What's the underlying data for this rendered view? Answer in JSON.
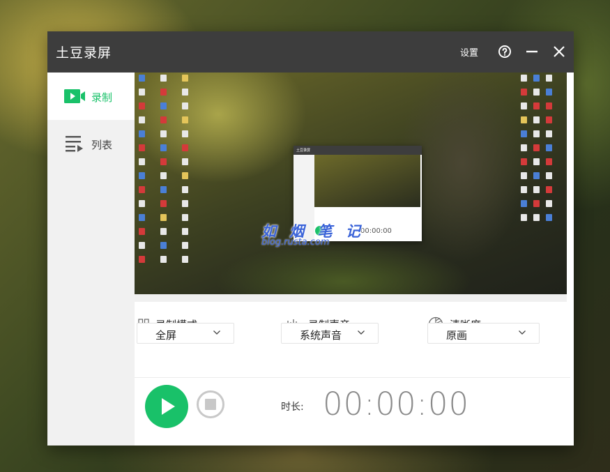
{
  "app": {
    "title": "土豆录屏",
    "settings_label": "设置"
  },
  "sidebar": {
    "items": [
      {
        "label": "录制",
        "icon": "video-camera-icon",
        "active": true
      },
      {
        "label": "列表",
        "icon": "list-play-icon",
        "active": false
      }
    ]
  },
  "preview": {
    "mini_title": "土豆录屏",
    "mini_time": "00:00:00"
  },
  "watermark": {
    "title": "如 烟 笔 记",
    "url": "blog.rusta.com"
  },
  "options": {
    "mode": {
      "label": "录制模式",
      "value": "全屏",
      "icon": "grid-icon"
    },
    "audio": {
      "label": "录制声音",
      "value": "系统声音",
      "icon": "sound-wave-icon"
    },
    "quality": {
      "label": "清晰度",
      "value": "原画",
      "icon": "quality-icon"
    }
  },
  "recording": {
    "duration_label": "时长:",
    "duration_value": "00:00:00"
  },
  "colors": {
    "accent": "#19c169",
    "titlebar": "#3d3d3d",
    "sidebar": "#f1f1f1"
  }
}
